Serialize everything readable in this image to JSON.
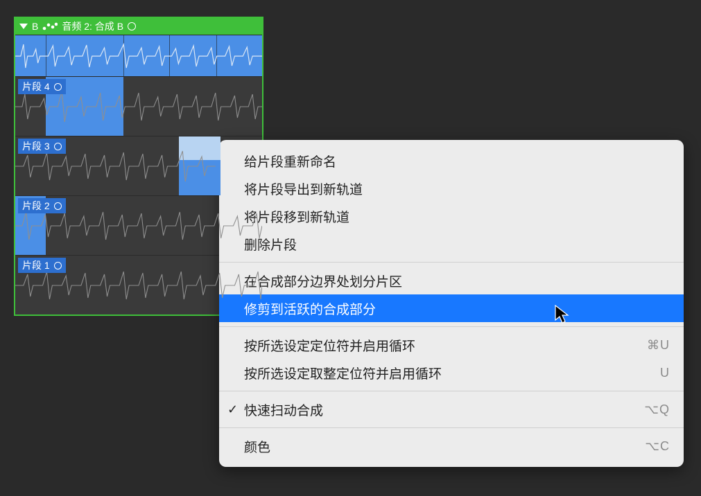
{
  "header": {
    "b_label": "B",
    "title": "音频 2: 合成 B"
  },
  "takes": [
    {
      "label": "片段 4"
    },
    {
      "label": "片段 3"
    },
    {
      "label": "片段 2"
    },
    {
      "label": "片段 1"
    }
  ],
  "menu": {
    "rename": "给片段重新命名",
    "export": "将片段导出到新轨道",
    "move": "将片段移到新轨道",
    "delete": "删除片段",
    "slice": "在合成部分边界处划分片区",
    "trim": "修剪到活跃的合成部分",
    "locators": "按所选设定定位符并启用循环",
    "locators_short": "⌘U",
    "roundlocators": "按所选设定取整定位符并启用循环",
    "roundlocators_short": "U",
    "quickswipe": "快速扫动合成",
    "quickswipe_short": "⌥Q",
    "color": "颜色",
    "color_short": "⌥C"
  }
}
